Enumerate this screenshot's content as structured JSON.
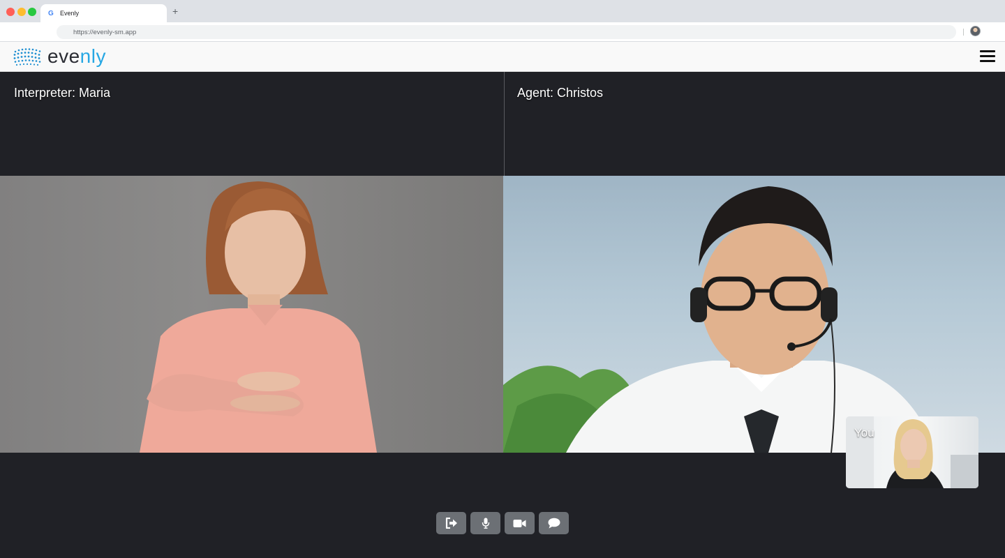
{
  "browser": {
    "tab_title": "Evenly",
    "favicon": "G",
    "new_tab": "+",
    "url": "https://evenly-sm.app"
  },
  "app": {
    "brand_part1": "eve",
    "brand_part2": "nly",
    "brand_color": "#27a7e3"
  },
  "call": {
    "left_label": "Interpreter: Maria",
    "right_label": "Agent: Christos",
    "self_label": "You"
  },
  "controls": [
    {
      "name": "leave-call-button",
      "icon": "sign-out-icon"
    },
    {
      "name": "microphone-button",
      "icon": "microphone-icon"
    },
    {
      "name": "camera-button",
      "icon": "video-camera-icon"
    },
    {
      "name": "chat-button",
      "icon": "chat-bubble-icon"
    }
  ]
}
